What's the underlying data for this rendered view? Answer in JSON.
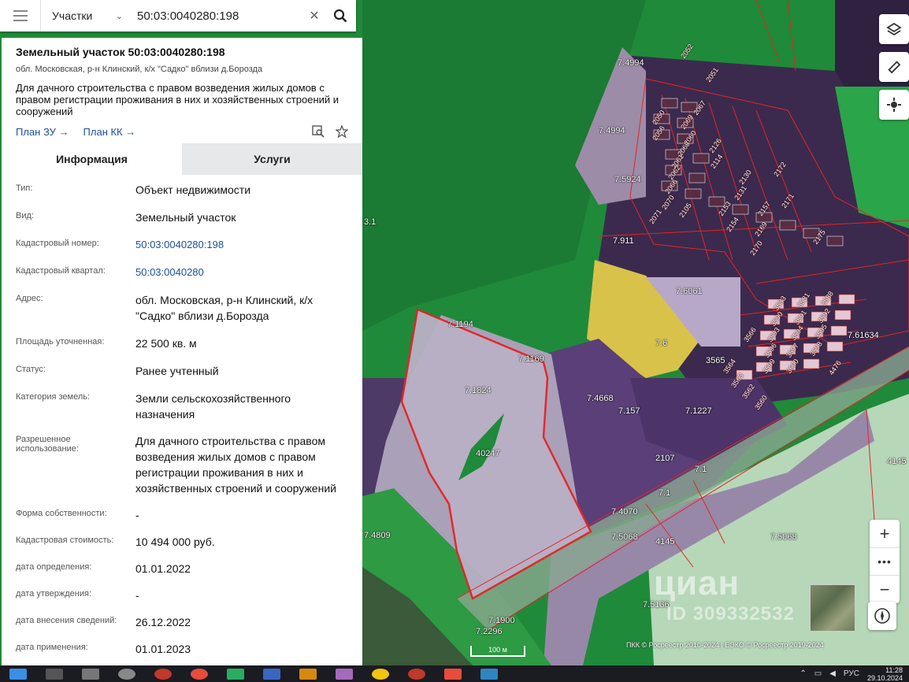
{
  "search": {
    "type_label": "Участки",
    "query": "50:03:0040280:198"
  },
  "card": {
    "title": "Земельный участок 50:03:0040280:198",
    "address_short": "обл. Московская, р-н Клинский, к/х \"Садко\" вблизи д.Борозда",
    "description": "Для дачного строительства с правом возведения жилых домов с правом регистрации проживания в них и хозяйственных строений и сооружений",
    "links": [
      "План ЗУ →",
      "План КК →"
    ]
  },
  "tabs": [
    {
      "label": "Информация",
      "active": true
    },
    {
      "label": "Услуги",
      "active": false
    }
  ],
  "info_rows": [
    {
      "label": "Тип:",
      "value": "Объект недвижимости"
    },
    {
      "label": "Вид:",
      "value": "Земельный участок"
    },
    {
      "label": "Кадастровый номер:",
      "value": "50:03:0040280:198",
      "link": true
    },
    {
      "label": "Кадастровый квартал:",
      "value": "50:03:0040280",
      "link": true
    },
    {
      "label": "Адрес:",
      "value": "обл. Московская, р-н Клинский, к/х \"Садко\" вблизи д.Борозда"
    },
    {
      "label": "Площадь уточненная:",
      "value": "22 500 кв. м"
    },
    {
      "label": "Статус:",
      "value": "Ранее учтенный"
    },
    {
      "label": "Категория земель:",
      "value": "Земли сельскохозяйственного назначения"
    },
    {
      "label": "Разрешенное использование:",
      "value": "Для дачного строительства с правом возведения жилых домов с правом регистрации проживания в них и хозяйственных строений и сооружений"
    },
    {
      "label": "Форма собственности:",
      "value": "-"
    },
    {
      "label": "Кадастровая стоимость:",
      "value": "10 494 000 руб."
    },
    {
      "label": "дата определения:",
      "value": "01.01.2022"
    },
    {
      "label": "дата утверждения:",
      "value": "-"
    },
    {
      "label": "дата внесения сведений:",
      "value": "26.12.2022"
    },
    {
      "label": "дата применения:",
      "value": "01.01.2023"
    }
  ],
  "map": {
    "plot_labels": [
      "7.4994",
      "7.4994",
      "7.5924",
      "7.911",
      "7.6061",
      "7.1194",
      "7.1169",
      "7.1824",
      "40247",
      "7.4668",
      "7.157",
      "7.1227",
      "7.61634",
      "7.4070",
      "7.5068",
      "7.5068",
      "7.4809",
      "7.1900",
      "7.2296",
      "7.5136",
      "2107",
      "4145",
      "3565",
      "7.1",
      "7.6",
      "4145",
      "7.1",
      "3.1"
    ],
    "lot_numbers": [
      "2067",
      "2069",
      "2050",
      "2060",
      "2056",
      "2068",
      "2061",
      "2062",
      "2066",
      "2070",
      "2071",
      "2105",
      "2114",
      "2126",
      "2130",
      "2131",
      "2153",
      "2154",
      "2157",
      "2169",
      "2170",
      "2171",
      "2172",
      "2175",
      "3583",
      "3581",
      "3588",
      "3566",
      "3590",
      "3591",
      "3592",
      "3593",
      "3594",
      "3595",
      "3596",
      "3597",
      "3598",
      "3599",
      "3600",
      "3564",
      "3563",
      "3562",
      "3560",
      "4476",
      "2051",
      "2052"
    ],
    "scale_label": "100 м",
    "copyright": "ПКК © Росреестр 2010-2024 | ЕЭКО © Росреестр 2019-2024",
    "watermark": "циан",
    "watermark_id": "ID 309332532"
  },
  "taskbar": {
    "language": "РУС",
    "time": "11:28",
    "date": "29.10.2024"
  },
  "colors": {
    "link": "#1a4f9c",
    "parcel_outline": "#e52424",
    "map_green": "#1f8a3a"
  }
}
